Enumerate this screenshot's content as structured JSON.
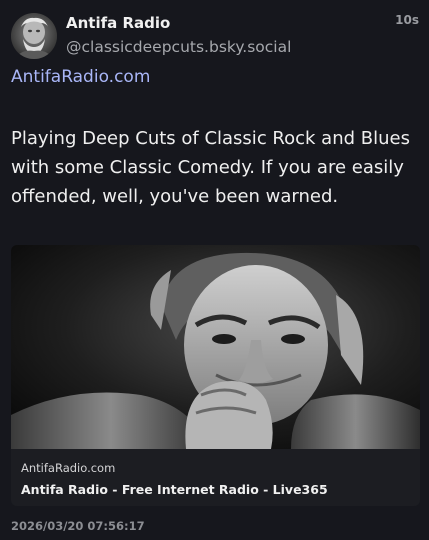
{
  "post": {
    "author": {
      "display_name": "Antifa Radio",
      "handle": "@classicdeepcuts.bsky.social",
      "avatar_icon": "avatar-photo"
    },
    "relative_time": "10s",
    "profile_link": "AntifaRadio.com",
    "text": "Playing Deep Cuts of Classic Rock and Blues with some Classic Comedy. If you are easily offended, well, you've been warned.",
    "embed": {
      "domain": "AntifaRadio.com",
      "title": "Antifa Radio - Free Internet Radio - Live365",
      "image_icon": "grayscale-portrait-photo"
    },
    "absolute_time": "2026/03/20 07:56:17"
  },
  "colors": {
    "background": "#16171d",
    "link": "#a9b6f7",
    "muted": "#a6a8ad",
    "embed_meta_bg": "#1c1d22"
  }
}
